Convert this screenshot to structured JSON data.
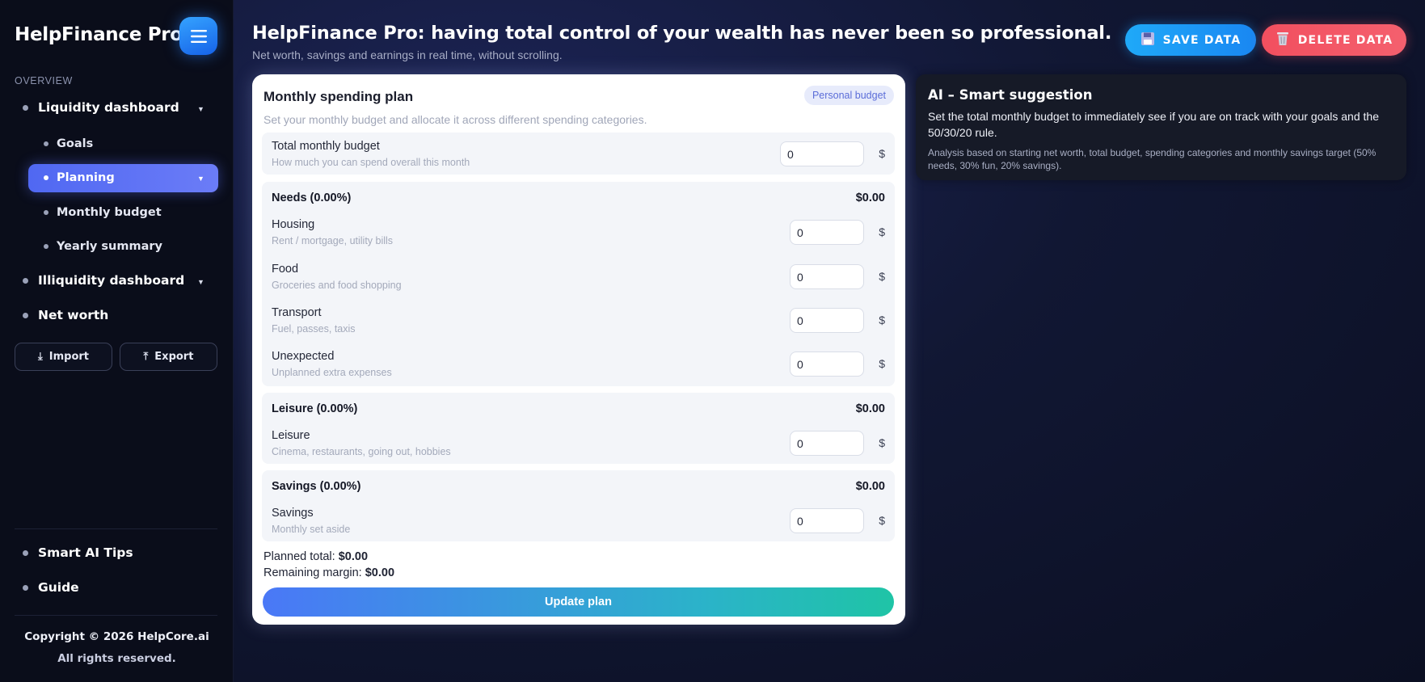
{
  "app": {
    "brand": "HelpFinance Pro",
    "headline": "HelpFinance Pro: having total control of your wealth has never been so professional.",
    "subheadline": "Net worth, savings and earnings in real time, without scrolling."
  },
  "sidebar": {
    "section_label": "OVERVIEW",
    "items": [
      {
        "label": "Liquidity dashboard",
        "expanded": true
      },
      {
        "label": "Goals"
      },
      {
        "label": "Planning",
        "active": true
      },
      {
        "label": "Monthly budget"
      },
      {
        "label": "Yearly summary"
      },
      {
        "label": "Illiquidity dashboard"
      },
      {
        "label": "Net worth"
      }
    ],
    "import_label": "Import",
    "export_label": "Export",
    "bottom_items": [
      {
        "label": "Smart AI Tips"
      },
      {
        "label": "Guide"
      }
    ],
    "copyright": "Copyright © 2026 HelpCore.ai",
    "rights": "All rights reserved."
  },
  "toolbar": {
    "save_label": "SAVE DATA",
    "delete_label": "DELETE DATA"
  },
  "plan": {
    "title": "Monthly spending plan",
    "badge": "Personal budget",
    "description": "Set your monthly budget and allocate it across different spending categories.",
    "total_budget": {
      "label": "Total monthly budget",
      "hint": "How much you can spend overall this month",
      "value": "0",
      "currency": "$"
    },
    "sections": [
      {
        "title": "Needs (0.00%)",
        "amount": "$0.00",
        "rows": [
          {
            "label": "Housing",
            "hint": "Rent / mortgage, utility bills",
            "value": "0",
            "currency": "$"
          },
          {
            "label": "Food",
            "hint": "Groceries and food shopping",
            "value": "0",
            "currency": "$"
          },
          {
            "label": "Transport",
            "hint": "Fuel, passes, taxis",
            "value": "0",
            "currency": "$"
          },
          {
            "label": "Unexpected",
            "hint": "Unplanned extra expenses",
            "value": "0",
            "currency": "$"
          }
        ]
      },
      {
        "title": "Leisure (0.00%)",
        "amount": "$0.00",
        "rows": [
          {
            "label": "Leisure",
            "hint": "Cinema, restaurants, going out, hobbies",
            "value": "0",
            "currency": "$"
          }
        ]
      },
      {
        "title": "Savings (0.00%)",
        "amount": "$0.00",
        "rows": [
          {
            "label": "Savings",
            "hint": "Monthly set aside",
            "value": "0",
            "currency": "$"
          }
        ]
      }
    ],
    "planned_total_label": "Planned total:",
    "planned_total_value": "$0.00",
    "remaining_label": "Remaining margin:",
    "remaining_value": "$0.00",
    "update_label": "Update plan"
  },
  "ai": {
    "title": "AI – Smart suggestion",
    "text": "Set the total monthly budget to immediately see if you are on track with your goals and the 50/30/20 rule.",
    "note": "Analysis based on starting net worth, total budget, spending categories and monthly savings target (50% needs, 30% fun, 20% savings)."
  },
  "icons": {
    "menu": "hamburger-menu-icon",
    "save": "floppy-disk-icon",
    "delete": "trash-bin-icon",
    "import": "download-icon",
    "export": "upload-icon",
    "caret": "caret-down-icon"
  },
  "colors": {
    "accent_blue": "#1f97f5",
    "danger_red": "#f2505f",
    "active_nav": "#5a6ef4",
    "teal": "#1fc4a6"
  }
}
